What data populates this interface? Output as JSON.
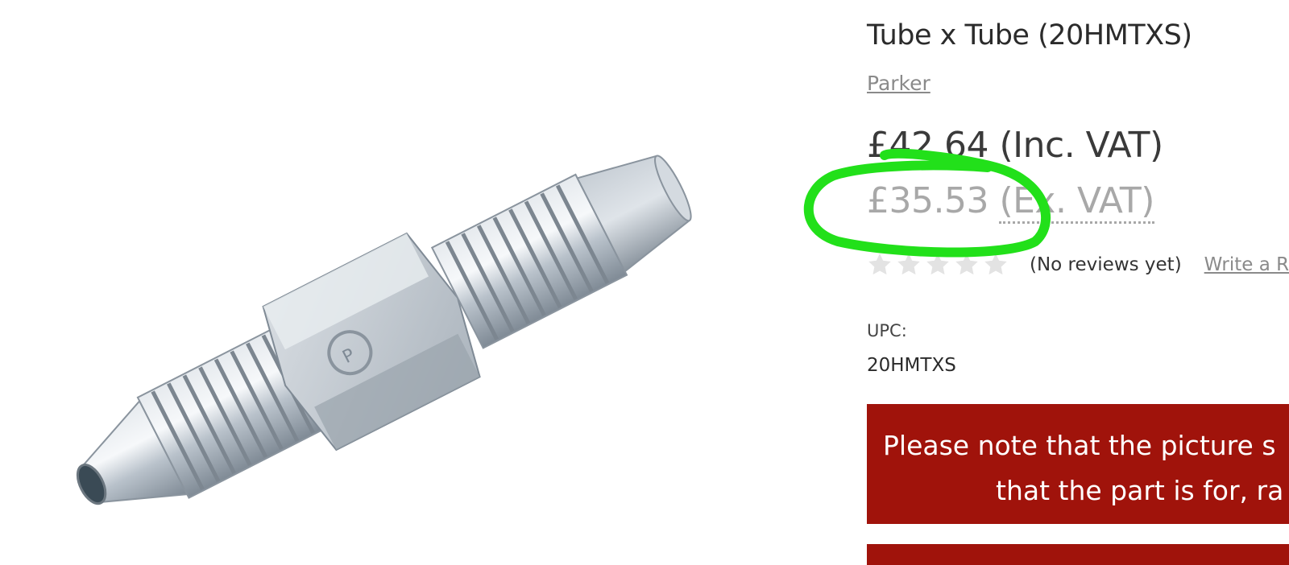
{
  "product": {
    "title": "Tube x Tube (20HMTXS)",
    "brand": "Parker",
    "price_inc": "£42.64",
    "price_inc_label": "(Inc. VAT)",
    "price_ex": "£35.53",
    "price_ex_label": "(Ex. VAT)",
    "rating": {
      "stars_filled": 0,
      "stars_total": 5,
      "no_reviews_text": "(No reviews yet)",
      "write_review_text": "Write a Review"
    },
    "upc_label": "UPC:",
    "upc_value": "20HMTXS",
    "notice": {
      "line1": "Please note that the picture s",
      "line2": "that the part is for, ra"
    }
  },
  "colors": {
    "notice_bg": "#a0130b",
    "annotation": "#22e01a",
    "star_empty": "#e3e3e3"
  },
  "icons": [
    "star-icon"
  ]
}
